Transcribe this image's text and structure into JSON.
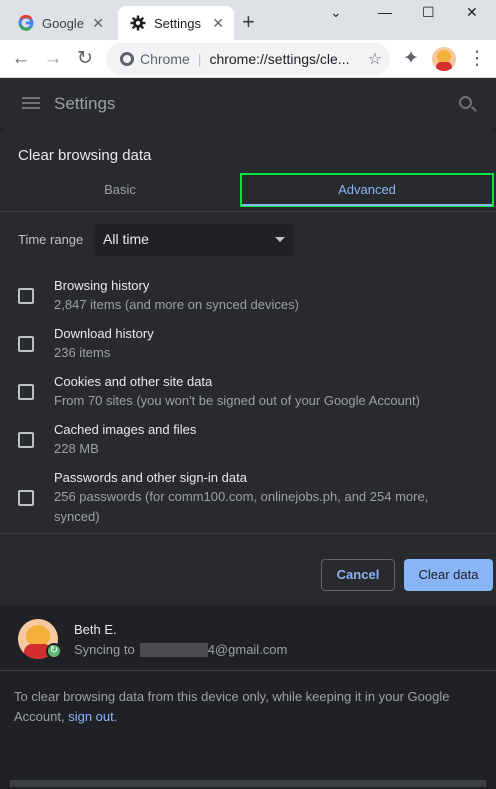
{
  "tabs": [
    {
      "title": "Google",
      "close": "✕"
    },
    {
      "title": "Settings",
      "close": "✕"
    }
  ],
  "newtab": "+",
  "window": {
    "minimize": "⌄",
    "min": "—",
    "max": "☐",
    "close": "✕"
  },
  "toolbar": {
    "back": "←",
    "forward": "→",
    "reload": "↻",
    "site_name": "Chrome",
    "url": "chrome://settings/cle...",
    "bookmark": "☆",
    "extensions": "✦",
    "menu": "⋮"
  },
  "settings": {
    "title": "Settings"
  },
  "dialog": {
    "title": "Clear browsing data",
    "tabs": {
      "basic": "Basic",
      "advanced": "Advanced"
    },
    "time_range": {
      "label": "Time range",
      "value": "All time"
    },
    "items": [
      {
        "label": "Browsing history",
        "desc": "2,847 items (and more on synced devices)"
      },
      {
        "label": "Download history",
        "desc": "236 items"
      },
      {
        "label": "Cookies and other site data",
        "desc": "From 70 sites (you won't be signed out of your Google Account)"
      },
      {
        "label": "Cached images and files",
        "desc": "228 MB"
      },
      {
        "label": "Passwords and other sign-in data",
        "desc": "256 passwords (for comm100.com, onlinejobs.ph, and 254 more, synced)"
      }
    ],
    "cancel": "Cancel",
    "clear": "Clear data"
  },
  "account": {
    "name": "Beth E.",
    "sync_prefix": "Syncing to",
    "email_suffix": "4@gmail.com",
    "note_text": "To clear browsing data from this device only, while keeping it in your Google Account, ",
    "sign_out": "sign out",
    "note_end": "."
  },
  "colors": {
    "accent": "#8ab4f8",
    "highlight": "#00e640",
    "dialog_bg": "#292a2d"
  }
}
